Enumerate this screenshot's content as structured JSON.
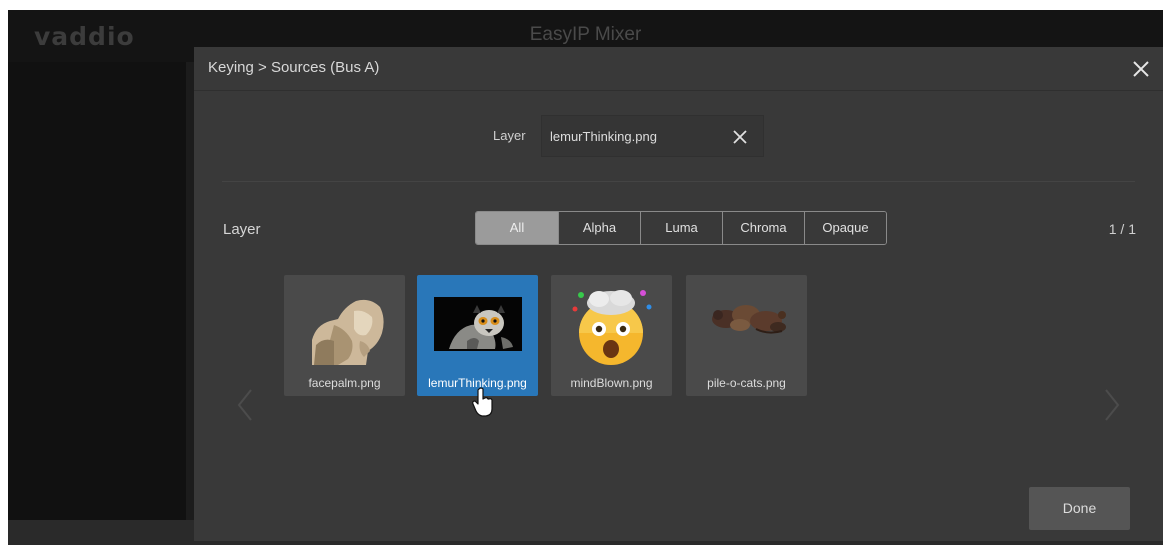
{
  "app": {
    "logo": "vaddio",
    "title": "EasyIP Mixer"
  },
  "modal": {
    "title": "Keying > Sources (Bus A)",
    "layer_field": {
      "label": "Layer",
      "value": "lemurThinking.png"
    },
    "section_label": "Layer",
    "filters": [
      {
        "label": "All",
        "active": true
      },
      {
        "label": "Alpha",
        "active": false
      },
      {
        "label": "Luma",
        "active": false
      },
      {
        "label": "Chroma",
        "active": false
      },
      {
        "label": "Opaque",
        "active": false
      }
    ],
    "page_count": "1 / 1",
    "tiles": [
      {
        "name": "facepalm.png",
        "selected": false
      },
      {
        "name": "lemurThinking.png",
        "selected": true
      },
      {
        "name": "mindBlown.png",
        "selected": false
      },
      {
        "name": "pile-o-cats.png",
        "selected": false
      }
    ],
    "done_label": "Done"
  },
  "colors": {
    "selected": "#2977b9",
    "modal_bg": "#393939",
    "active_filter": "#9b9b9b"
  },
  "icons": [
    "close-icon",
    "clear-icon",
    "chevron-left-icon",
    "chevron-right-icon",
    "hand-pointer-icon"
  ]
}
